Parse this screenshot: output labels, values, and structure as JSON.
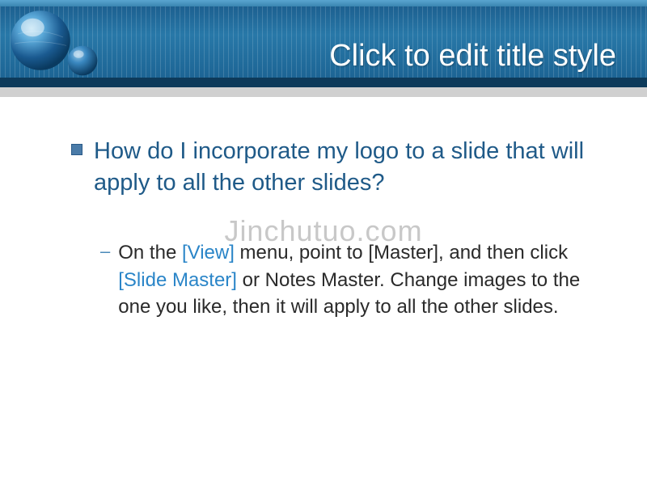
{
  "header": {
    "title": "Click to edit title style"
  },
  "watermark": "Jinchutuo.com",
  "content": {
    "question": "How do I incorporate my logo to a slide that will apply to all the other slides?",
    "answer": {
      "part1": "On the ",
      "link1": "[View]",
      "part2": " menu, point to [Master], and then click ",
      "link2": "[Slide Master]",
      "part3": " or Notes Master. Change images to the one you like, then it will apply to all the other slides."
    }
  }
}
